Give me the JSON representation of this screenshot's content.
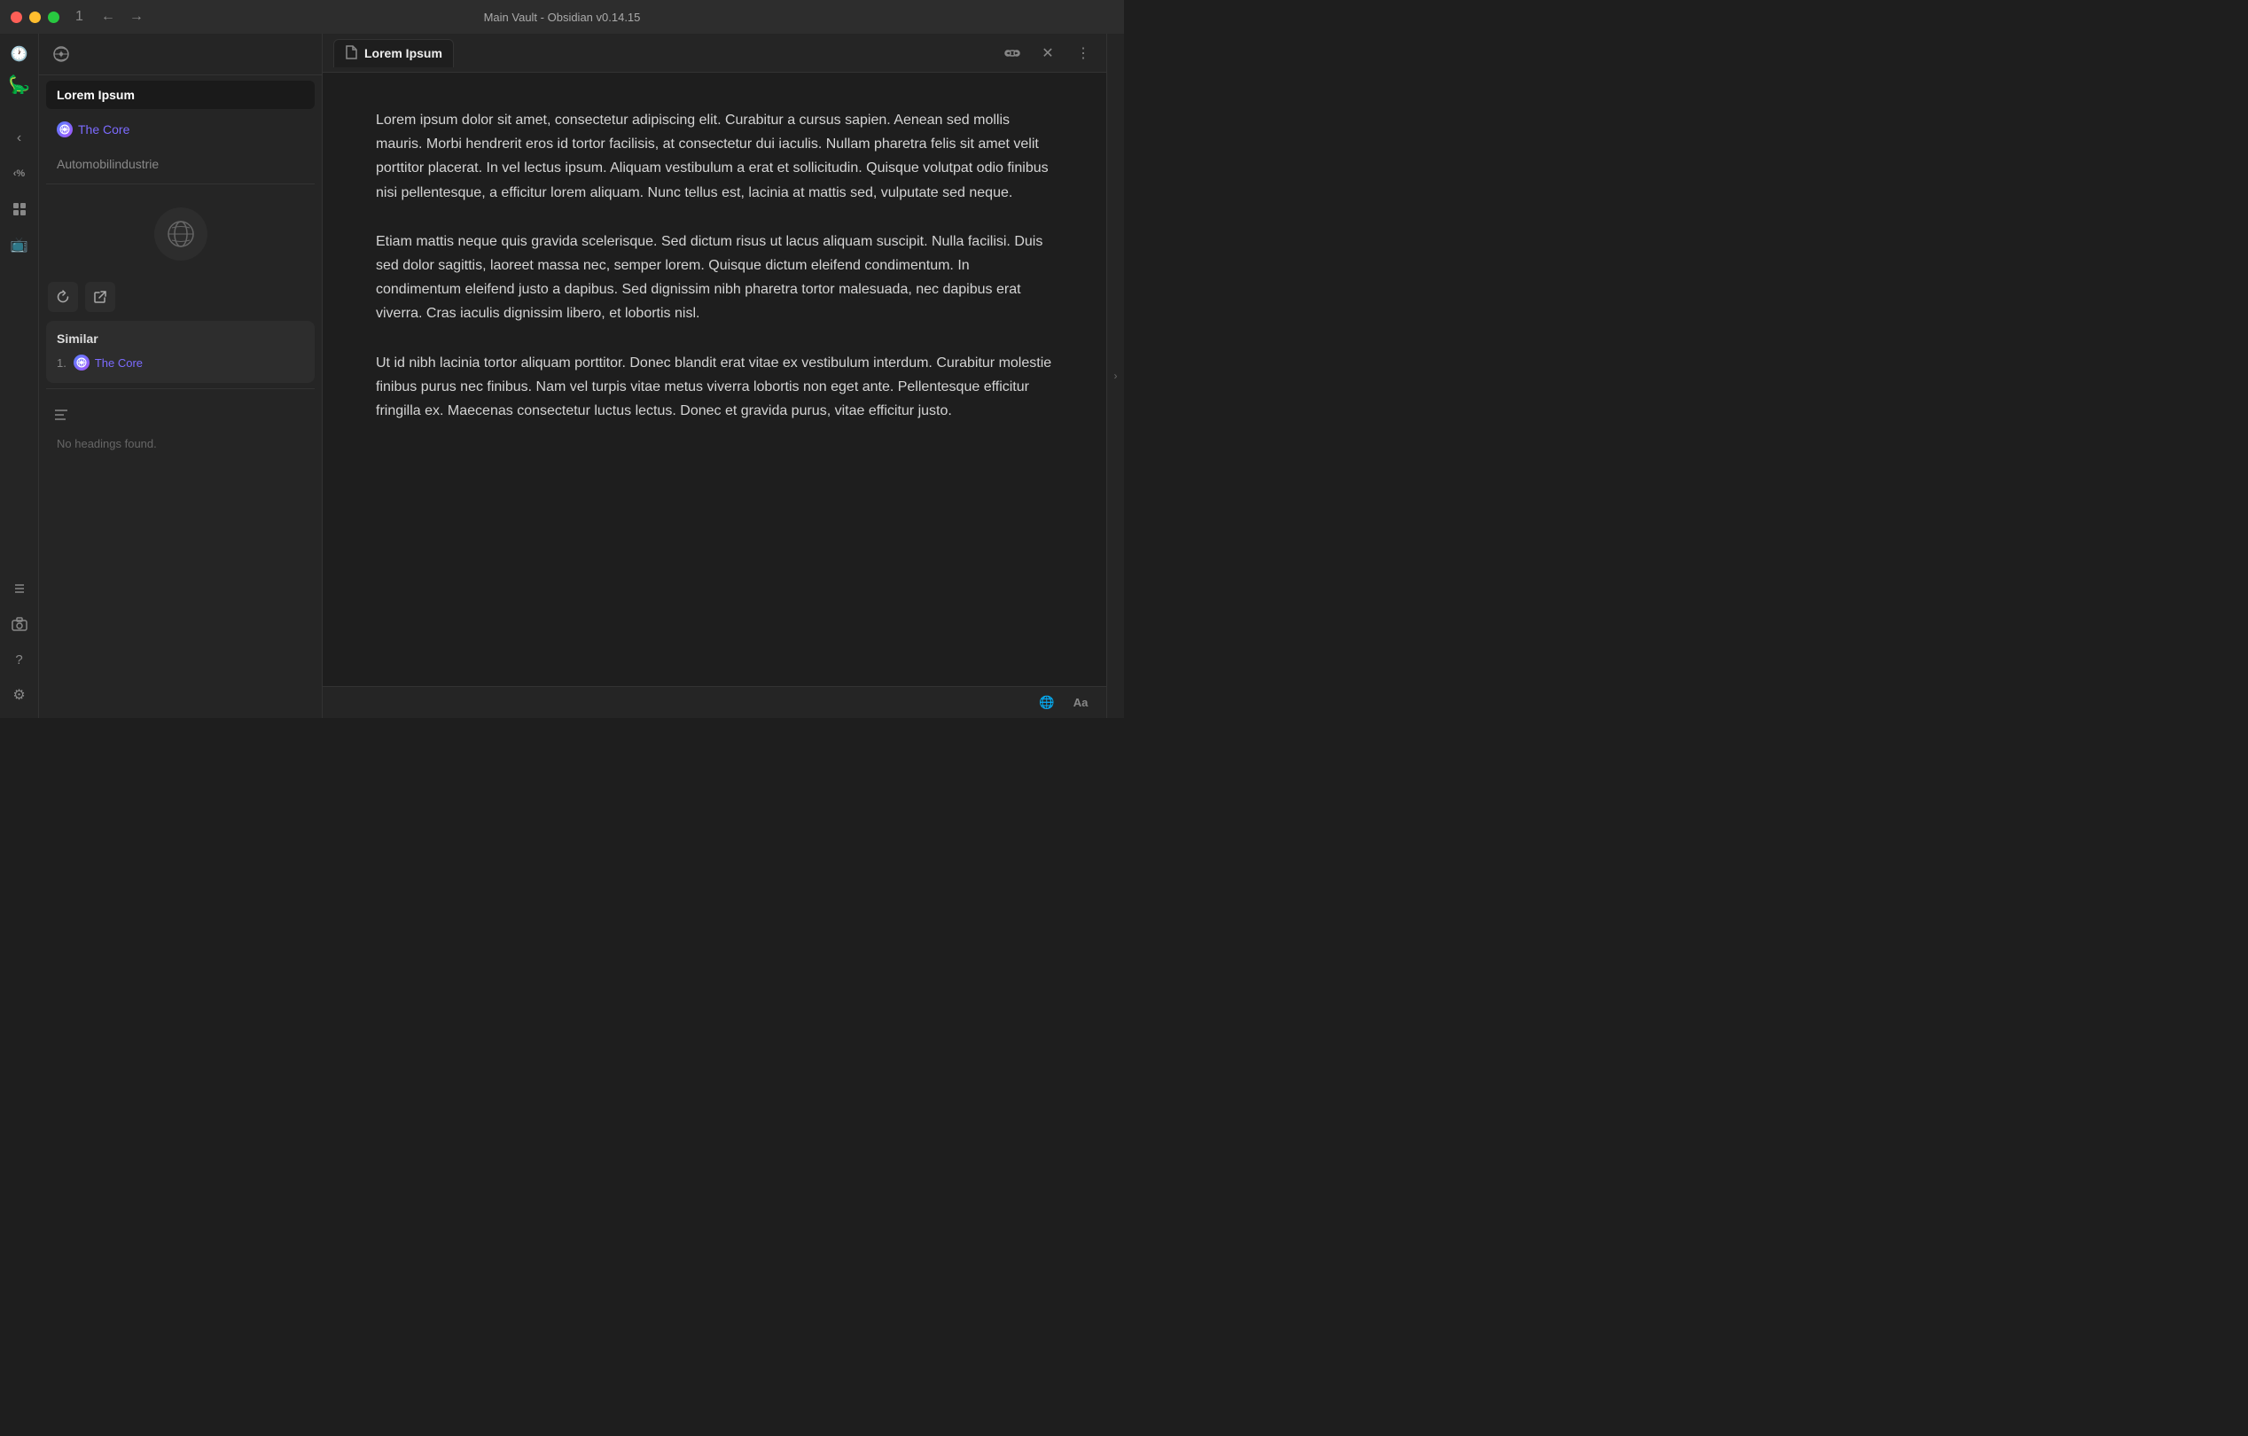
{
  "titlebar": {
    "title": "Main Vault - Obsidian v0.14.15",
    "tab_num": "1",
    "nav_back": "←",
    "nav_forward": "→"
  },
  "sidebar": {
    "notes": [
      {
        "label": "Lorem Ipsum",
        "type": "active"
      },
      {
        "label": "The Core",
        "type": "link"
      },
      {
        "label": "Automobilindustrie",
        "type": "muted"
      }
    ],
    "similar_title": "Similar",
    "similar_items": [
      {
        "num": "1.",
        "label": "The Core"
      }
    ],
    "no_headings": "No headings found."
  },
  "tab": {
    "icon": "📄",
    "label": "Lorem Ipsum",
    "actions": {
      "reading_view": "👓",
      "close": "✕",
      "more": "⋮"
    }
  },
  "editor": {
    "paragraphs": [
      "Lorem ipsum dolor sit amet, consectetur adipiscing elit. Curabitur a cursus sapien. Aenean sed mollis mauris. Morbi hendrerit eros id tortor facilisis, at consectetur dui iaculis. Nullam pharetra felis sit amet velit porttitor placerat. In vel lectus ipsum. Aliquam vestibulum a erat et sollicitudin. Quisque volutpat odio finibus nisi pellentesque, a efficitur lorem aliquam. Nunc tellus est, lacinia at mattis sed, vulputate sed neque.",
      "Etiam mattis neque quis gravida scelerisque. Sed dictum risus ut lacus aliquam suscipit. Nulla facilisi. Duis sed dolor sagittis, laoreet massa nec, semper lorem. Quisque dictum eleifend condimentum. In condimentum eleifend justo a dapibus. Sed dignissim nibh pharetra tortor malesuada, nec dapibus erat viverra. Cras iaculis dignissim libero, et lobortis nisl.",
      "Ut id nibh lacinia tortor aliquam porttitor. Donec blandit erat vitae ex vestibulum interdum. Curabitur molestie finibus purus nec finibus. Nam vel turpis vitae metus viverra lobortis non eget ante. Pellentesque efficitur fringilla ex. Maecenas consectetur luctus lectus. Donec et gravida purus, vitae efficitur justo."
    ]
  },
  "ribbon": {
    "icons": [
      {
        "name": "history-icon",
        "glyph": "🕐"
      },
      {
        "name": "bookmark-icon",
        "glyph": "🦕"
      }
    ],
    "bottom_icons": [
      {
        "name": "nav-left-icon",
        "glyph": "‹"
      },
      {
        "name": "percent-icon",
        "glyph": "<%"
      },
      {
        "name": "dashboard-icon",
        "glyph": "⊞"
      },
      {
        "name": "tv-icon",
        "glyph": "📺"
      },
      {
        "name": "list-icon",
        "glyph": "☰"
      },
      {
        "name": "camera-icon",
        "glyph": "📷"
      },
      {
        "name": "help-icon",
        "glyph": "?"
      },
      {
        "name": "settings-icon",
        "glyph": "⚙"
      }
    ]
  },
  "bottom_bar": {
    "globe_icon": "🌐",
    "font_icon": "Aa"
  }
}
